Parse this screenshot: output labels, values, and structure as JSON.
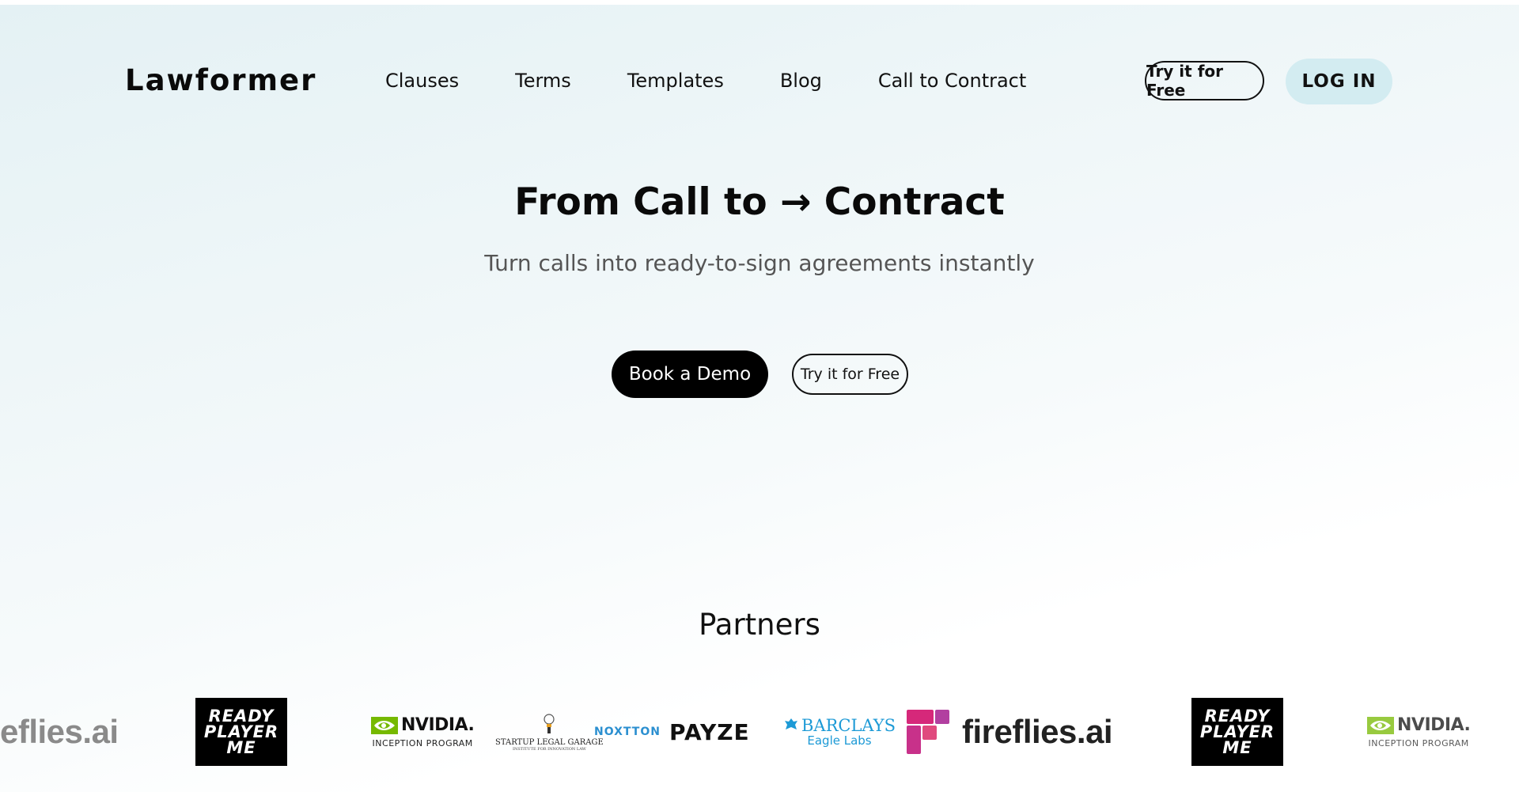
{
  "header": {
    "logo": "Lawformer",
    "nav": [
      "Clauses",
      "Terms",
      "Templates",
      "Blog",
      "Call to Contract"
    ],
    "try_free": "Try it for Free",
    "login": "LOG IN"
  },
  "hero": {
    "title": "From Call to → Contract",
    "subtitle": "Turn calls into ready-to-sign agreements instantly",
    "book_demo": "Book a Demo",
    "try_free": "Try it for Free"
  },
  "partners": {
    "title": "Partners",
    "logos": {
      "fireflies_partial": "eflies.ai",
      "rpm_line1": "READY",
      "rpm_line2": "PLAYER",
      "rpm_line3": "ME",
      "nvidia_name": "NVIDIA.",
      "nvidia_sub": "INCEPTION PROGRAM",
      "slg_name": "STARTUP LEGAL GARAGE",
      "slg_sub": "INSTITUTE FOR INNOVATION LAW",
      "noxtton": "NOXTTON",
      "payze": "PAYZE",
      "barclays_name": "BARCLAYS",
      "barclays_sub": "Eagle Labs",
      "fireflies": "fireflies.ai"
    }
  },
  "colors": {
    "login_bg": "#d3ecf1",
    "nvidia_green": "#76b900",
    "barclays_blue": "#1d9ad6",
    "fireflies_pink": "#d6287a",
    "noxtton_blue": "#2b8fd0"
  }
}
